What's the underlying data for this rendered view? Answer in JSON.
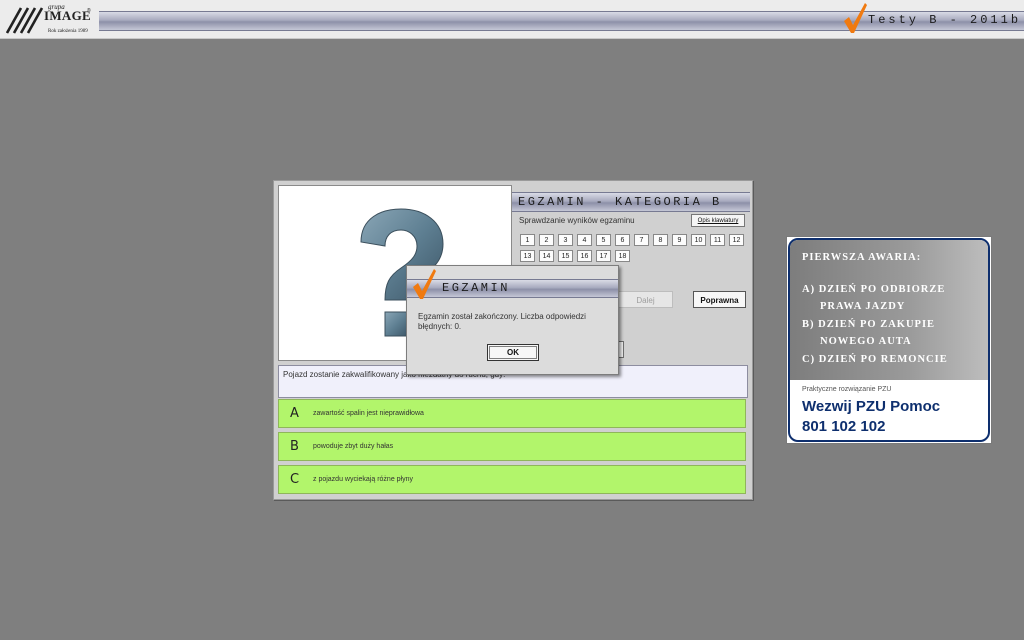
{
  "colors": {
    "background": "#7f7f7f",
    "header_strip": "#a8abbf",
    "check_orange": "#f07a10",
    "answer_green": "#b2f56b",
    "ad_blue": "#0e2f6e",
    "question_mark": "#5e7f92"
  },
  "header": {
    "logo": {
      "grupa": "grupa",
      "name": "IMAGE",
      "reg": "®",
      "since": "Rok założenia 1989"
    },
    "title": "Testy B - 2011b",
    "icon": "checkmark-icon"
  },
  "exam": {
    "title": "Egzamin - kategoria B",
    "image_icon": "question-mark-icon",
    "check_label": "Sprawdzanie wyników egzaminu",
    "keyboard_button": "Opis klawiatury",
    "question_numbers": [
      "1",
      "2",
      "3",
      "4",
      "5",
      "6",
      "7",
      "8",
      "9",
      "10",
      "11",
      "12",
      "13",
      "14",
      "15",
      "16",
      "17",
      "18"
    ],
    "next_button": "Dalej",
    "correct_button": "Poprawna",
    "question": "Pojazd zostanie zakwalifikowany jako niezdatny do ruchu, gdy:",
    "answers": [
      {
        "letter": "A",
        "text": "zawartość spalin jest nieprawidłowa"
      },
      {
        "letter": "B",
        "text": "powoduje zbyt duży hałas"
      },
      {
        "letter": "C",
        "text": "z pojazdu wyciekają różne płyny"
      }
    ]
  },
  "dialog": {
    "title": "Egzamin",
    "message": "Egzamin został zakończony. Liczba odpowiedzi błędnych: 0.",
    "ok": "OK"
  },
  "ad": {
    "lines": [
      "PIERWSZA AWARIA:",
      "A) DZIEŃ PO ODBIORZE",
      "PRAWA JAZDY",
      "B) DZIEŃ PO ZAKUPIE",
      "NOWEGO AUTA",
      "C) DZIEŃ PO REMONCIE"
    ],
    "small": "Praktyczne rozwiązanie PZU",
    "big1": "Wezwij PZU Pomoc",
    "big2": "801 102 102"
  }
}
